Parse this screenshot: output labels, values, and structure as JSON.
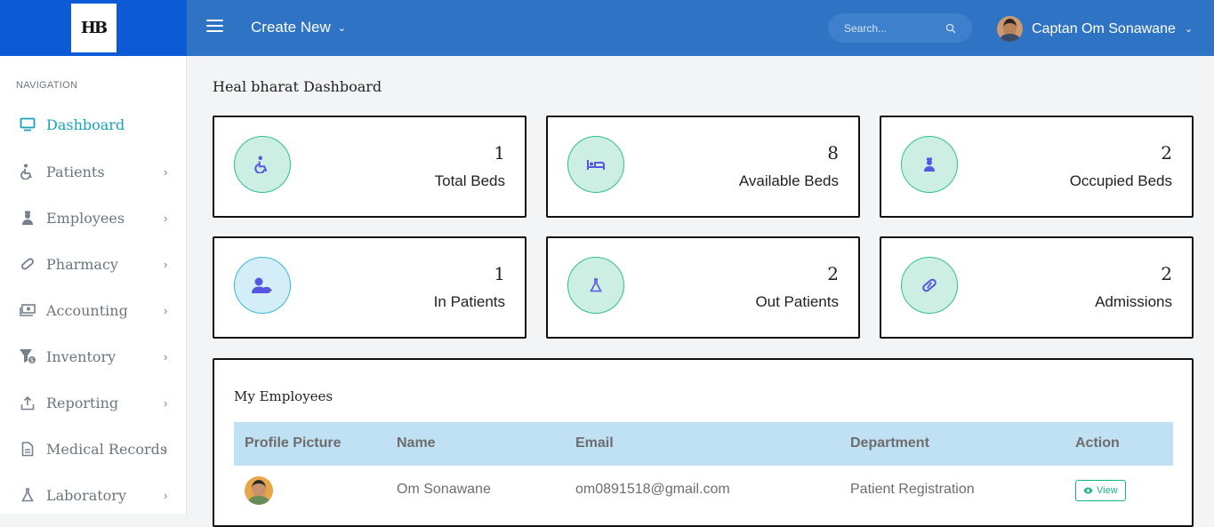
{
  "brand": {
    "logo_text": "HB"
  },
  "header": {
    "create_new": "Create New",
    "search_placeholder": "Search...",
    "user_name": "Captan Om Sonawane"
  },
  "sidebar": {
    "heading": "NAVIGATION",
    "items": [
      {
        "label": "Dashboard",
        "icon": "monitor-icon",
        "active": true
      },
      {
        "label": "Patients",
        "icon": "wheelchair-icon"
      },
      {
        "label": "Employees",
        "icon": "user-nurse-icon"
      },
      {
        "label": "Pharmacy",
        "icon": "pill-icon"
      },
      {
        "label": "Accounting",
        "icon": "money-icon"
      },
      {
        "label": "Inventory",
        "icon": "filter-dollar-icon"
      },
      {
        "label": "Reporting",
        "icon": "upload-icon"
      },
      {
        "label": "Medical Records",
        "icon": "file-icon"
      },
      {
        "label": "Laboratory",
        "icon": "flask-icon"
      }
    ]
  },
  "main": {
    "title": "Heal bharat Dashboard",
    "cards": [
      {
        "value": "1",
        "label": "Total Beds",
        "icon": "wheelchair-icon"
      },
      {
        "value": "8",
        "label": "Available Beds",
        "icon": "bed-icon"
      },
      {
        "value": "2",
        "label": "Occupied Beds",
        "icon": "user-nurse-icon"
      },
      {
        "value": "1",
        "label": "In Patients",
        "icon": "user-tag-icon"
      },
      {
        "value": "2",
        "label": "Out Patients",
        "icon": "flask-icon"
      },
      {
        "value": "2",
        "label": "Admissions",
        "icon": "capsule-icon"
      }
    ],
    "employees": {
      "title": "My Employees",
      "columns": [
        "Profile Picture",
        "Name",
        "Email",
        "Department",
        "Action"
      ],
      "rows": [
        {
          "name": "Om Sonawane",
          "email": "om0891518@gmail.com",
          "department": "Patient Registration",
          "action": "View"
        }
      ]
    }
  },
  "colors": {
    "topbar": "#2f73c4",
    "brand": "#0c5ad6",
    "active": "#18a2b8",
    "accent_green": "#18b28b"
  }
}
